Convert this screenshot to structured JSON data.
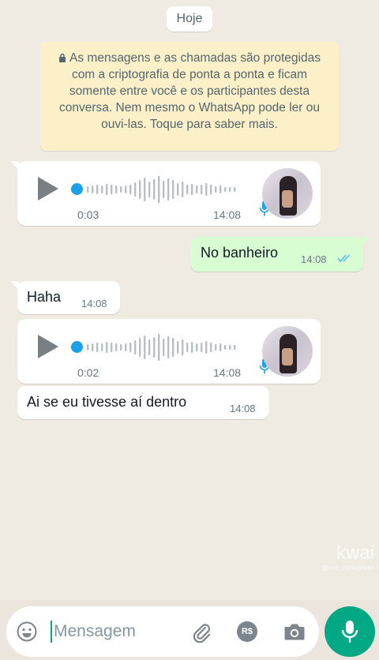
{
  "chat": {
    "date_chip": "Hoje",
    "encryption_notice": "As mensagens e as chamadas são protegidas com a criptografia de ponta a ponta e ficam somente entre você e os participantes desta conversa. Nem mesmo o WhatsApp pode ler ou ouvi-las. Toque para saber mais.",
    "messages": [
      {
        "type": "voice",
        "direction": "incoming",
        "duration": "0:03",
        "time": "14:08"
      },
      {
        "type": "text",
        "direction": "outgoing",
        "text": "No banheiro",
        "time": "14:08",
        "status": "read"
      },
      {
        "type": "text",
        "direction": "incoming",
        "text": "Haha",
        "time": "14:08"
      },
      {
        "type": "voice",
        "direction": "incoming",
        "duration": "0:02",
        "time": "14:08"
      },
      {
        "type": "text",
        "direction": "incoming",
        "text": "Ai se eu tivesse aí dentro",
        "time": "14:08"
      }
    ]
  },
  "watermark": {
    "brand": "kwai",
    "handle": "@cat_conversas"
  },
  "composer": {
    "placeholder": "Mensagem",
    "pay_label": "R$"
  },
  "colors": {
    "accent": "#00a884",
    "outgoing_bubble": "#d9fdd3",
    "incoming_bubble": "#ffffff",
    "notice_bg": "#fcf0c8",
    "read_ticks": "#53bdeb",
    "voice_dot": "#1da1e6"
  },
  "icons": [
    "lock-icon",
    "play-icon",
    "mic-icon",
    "double-check-icon",
    "emoji-icon",
    "attach-icon",
    "pay-icon",
    "camera-icon"
  ]
}
